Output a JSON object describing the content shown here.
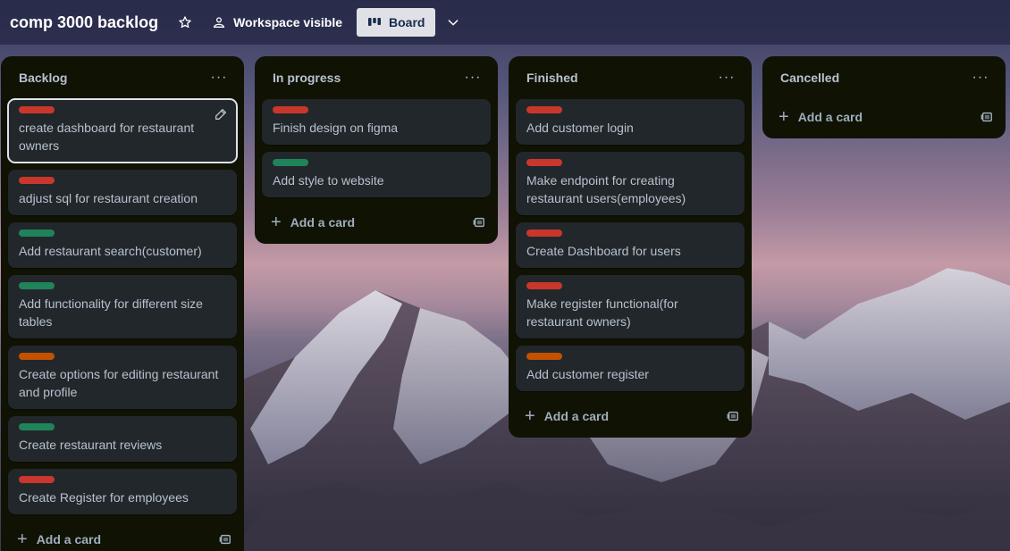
{
  "colors": {
    "red": "#c9372c",
    "green": "#1f845a",
    "orange": "#c25100",
    "list_bg": "#101204",
    "card_bg": "#22272b"
  },
  "header": {
    "title": "comp 3000 backlog",
    "star_icon": "star-icon",
    "visibility_label": "Workspace visible",
    "view_label": "Board"
  },
  "lists": [
    {
      "title": "Backlog",
      "menu": "···",
      "cards": [
        {
          "label": "red",
          "text": "create dashboard for restaurant owners"
        },
        {
          "label": "red",
          "text": "adjust sql for restaurant creation"
        },
        {
          "label": "green",
          "text": "Add restaurant search(customer)"
        },
        {
          "label": "green",
          "text": "Add functionality for different size tables"
        },
        {
          "label": "orange",
          "text": "Create options for editing restaurant and profile"
        },
        {
          "label": "green",
          "text": "Create restaurant reviews"
        },
        {
          "label": "red",
          "text": "Create Register for employees"
        }
      ],
      "add_label": "Add a card"
    },
    {
      "title": "In progress",
      "menu": "···",
      "cards": [
        {
          "label": "red",
          "text": "Finish design on figma"
        },
        {
          "label": "green",
          "text": "Add style to website"
        }
      ],
      "add_label": "Add a card"
    },
    {
      "title": "Finished",
      "menu": "···",
      "cards": [
        {
          "label": "red",
          "text": "Add customer login"
        },
        {
          "label": "red",
          "text": "Make endpoint for creating restaurant users(employees)"
        },
        {
          "label": "red",
          "text": "Create Dashboard for users"
        },
        {
          "label": "red",
          "text": "Make register functional(for restaurant owners)"
        },
        {
          "label": "orange",
          "text": "Add customer register"
        }
      ],
      "add_label": "Add a card"
    },
    {
      "title": "Cancelled",
      "menu": "···",
      "cards": [],
      "add_label": "Add a card"
    }
  ]
}
